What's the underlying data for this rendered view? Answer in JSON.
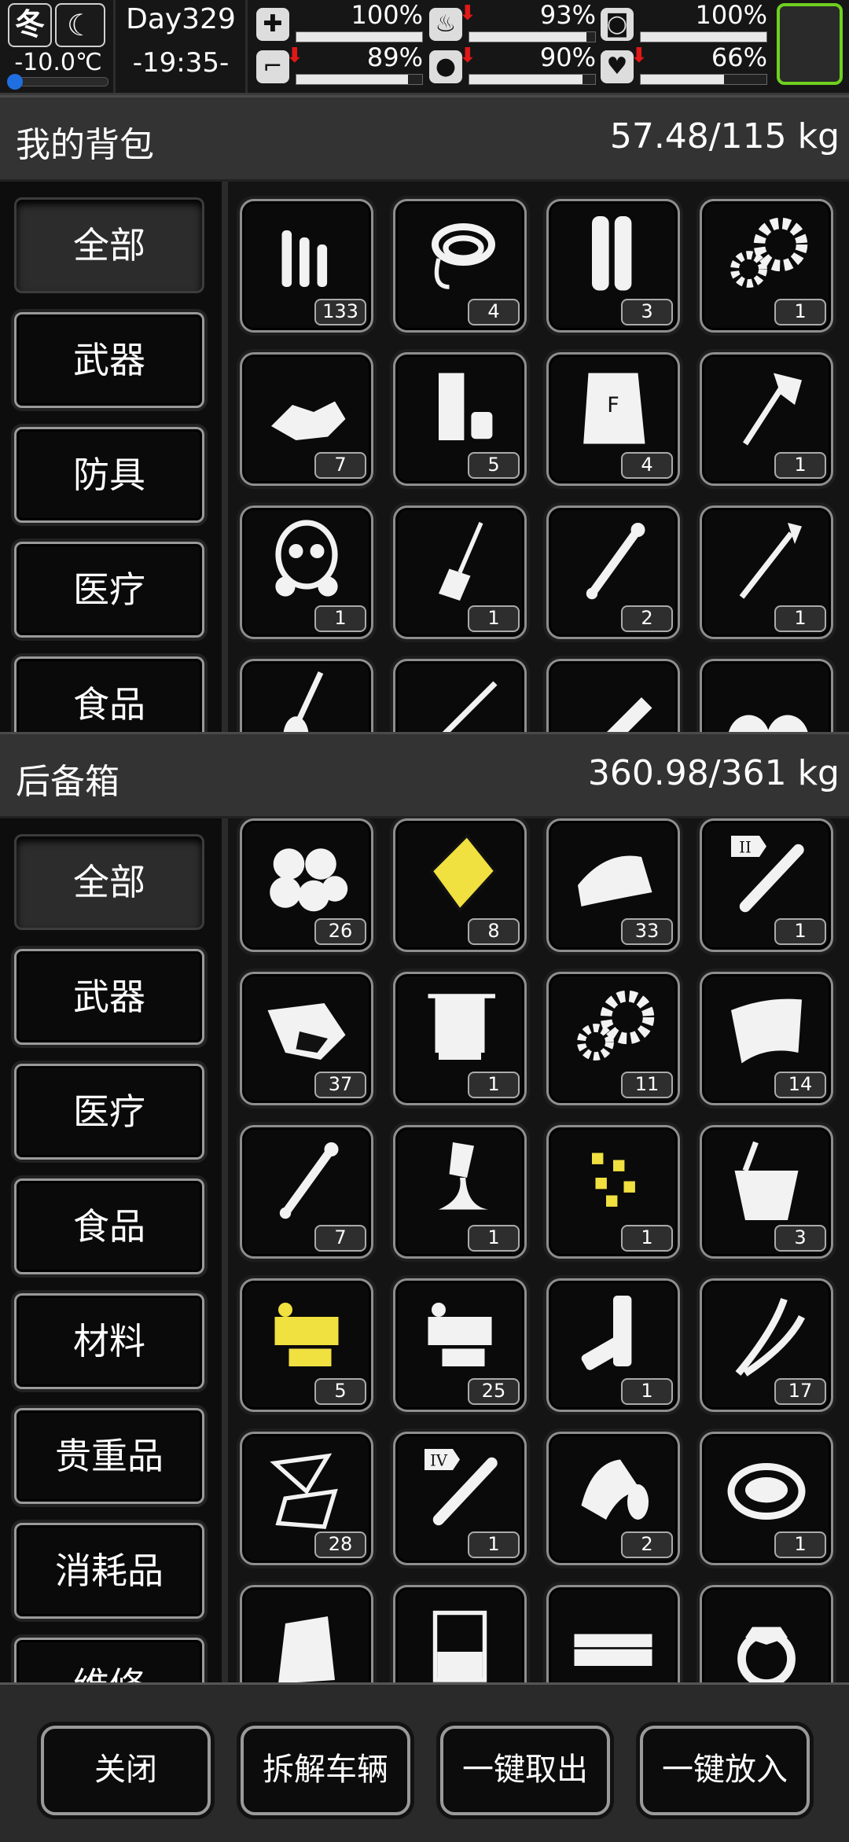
{
  "status": {
    "season": "冬",
    "temperature": "-10.0℃",
    "day": "Day329",
    "time": "-19:35-",
    "stats": [
      {
        "icon": "medkit-icon",
        "glyph": "✚",
        "value": "100%",
        "level": 100,
        "down": false
      },
      {
        "icon": "stomach-icon",
        "glyph": "♨",
        "value": "93%",
        "level": 93,
        "down": true
      },
      {
        "icon": "bladder-icon",
        "glyph": "◙",
        "value": "100%",
        "level": 100,
        "down": false
      },
      {
        "icon": "boot-icon",
        "glyph": "⌐",
        "value": "89%",
        "level": 89,
        "down": true
      },
      {
        "icon": "water-drop-icon",
        "glyph": "●",
        "value": "90%",
        "level": 90,
        "down": true
      },
      {
        "icon": "heart-icon",
        "glyph": "♥",
        "value": "66%",
        "level": 66,
        "down": true
      }
    ]
  },
  "backpack": {
    "title": "我的背包",
    "weight": "57.48/115 kg",
    "tabs": [
      "全部",
      "武器",
      "防具",
      "医疗",
      "食品"
    ],
    "items": [
      {
        "icon": "bullets-icon",
        "count": "133"
      },
      {
        "icon": "rope-icon",
        "count": "4"
      },
      {
        "icon": "shells-icon",
        "count": "3"
      },
      {
        "icon": "gears-icon",
        "count": "1"
      },
      {
        "icon": "rubble-icon",
        "count": "7"
      },
      {
        "icon": "cans-icon",
        "count": "5"
      },
      {
        "icon": "fertilizer-bag-icon",
        "count": "4"
      },
      {
        "icon": "axe-icon",
        "count": "1"
      },
      {
        "icon": "gas-mask-icon",
        "count": "1"
      },
      {
        "icon": "spatula-icon",
        "count": "1"
      },
      {
        "icon": "pipe-icon",
        "count": "2"
      },
      {
        "icon": "spear-icon",
        "count": "1"
      },
      {
        "icon": "shovel-icon",
        "count": ""
      },
      {
        "icon": "rifle-icon",
        "count": ""
      },
      {
        "icon": "ruler-icon",
        "count": ""
      },
      {
        "icon": "knee-pads-icon",
        "count": ""
      }
    ]
  },
  "trunk": {
    "title": "后备箱",
    "weight": "360.98/361 kg",
    "tabs": [
      "全部",
      "武器",
      "医疗",
      "食品",
      "材料",
      "贵重品",
      "消耗品",
      "维修"
    ],
    "items": [
      {
        "icon": "cotton-balls-icon",
        "count": "26"
      },
      {
        "icon": "yellow-plate-icon",
        "count": "8"
      },
      {
        "icon": "cloth-icon",
        "count": "33"
      },
      {
        "icon": "test-tube-ii-icon",
        "count": "1"
      },
      {
        "icon": "ore-icon",
        "count": "37"
      },
      {
        "icon": "circuit-board-icon",
        "count": "1"
      },
      {
        "icon": "gears-icon",
        "count": "11"
      },
      {
        "icon": "metal-sheet-icon",
        "count": "14"
      },
      {
        "icon": "pipe-icon",
        "count": "7"
      },
      {
        "icon": "glue-icon",
        "count": "1"
      },
      {
        "icon": "yellow-nuggets-icon",
        "count": "1"
      },
      {
        "icon": "bucket-icon",
        "count": "3"
      },
      {
        "icon": "yellow-electronics-icon",
        "count": "5"
      },
      {
        "icon": "electronics-icon",
        "count": "25"
      },
      {
        "icon": "batteries-icon",
        "count": "1"
      },
      {
        "icon": "wires-icon",
        "count": "17"
      },
      {
        "icon": "glass-shards-icon",
        "count": "28"
      },
      {
        "icon": "test-tube-iv-icon",
        "count": "1"
      },
      {
        "icon": "tape-roll-icon",
        "count": "2"
      },
      {
        "icon": "pot-icon",
        "count": "1"
      },
      {
        "icon": "bag-icon",
        "count": ""
      },
      {
        "icon": "beaker-icon",
        "count": ""
      },
      {
        "icon": "cash-icon",
        "count": ""
      },
      {
        "icon": "ring-icon",
        "count": ""
      }
    ]
  },
  "buttons": [
    "关闭",
    "拆解车辆",
    "一键取出",
    "一键放入"
  ],
  "colors": {
    "accent_green": "#6ed11e",
    "alert_red": "#e01818",
    "highlight_yellow": "#f0e040",
    "temp_blue": "#1f6fe0"
  }
}
